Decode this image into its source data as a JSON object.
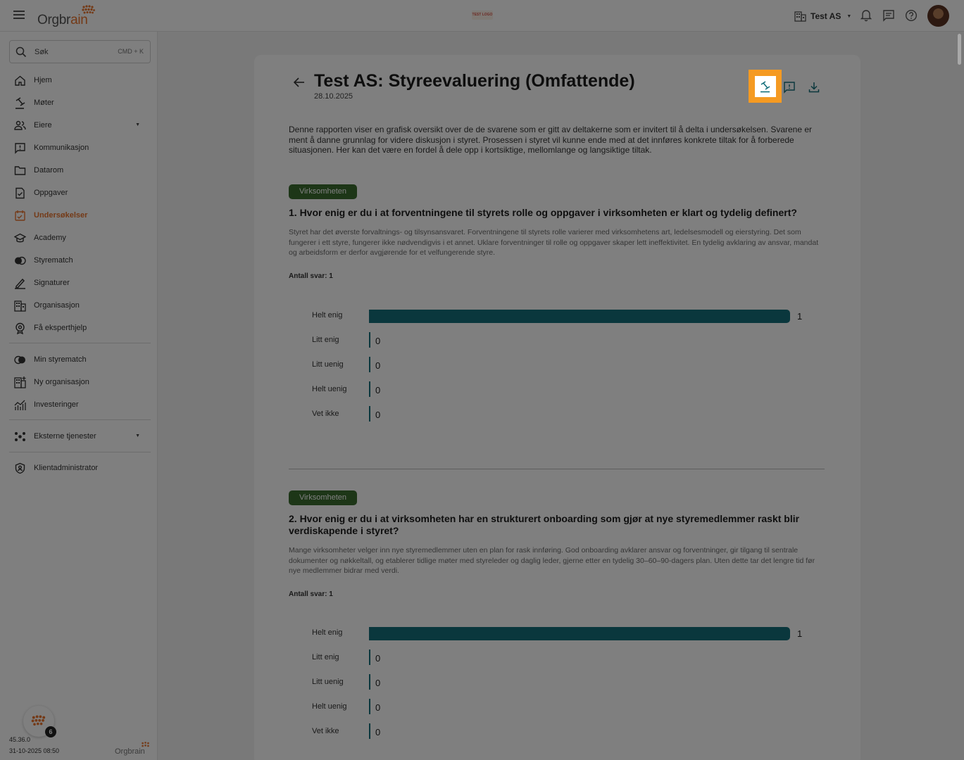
{
  "topbar": {
    "logo_text_main": "Orgbr",
    "logo_text_accent": "ain",
    "center_logo": "TEST LOGO",
    "org_name": "Test AS"
  },
  "sidebar": {
    "search_label": "Søk",
    "search_shortcut": "CMD + K",
    "items": [
      {
        "label": "Hjem",
        "icon": "home-icon"
      },
      {
        "label": "Møter",
        "icon": "gavel-icon"
      },
      {
        "label": "Eiere",
        "icon": "people-icon"
      },
      {
        "label": "Kommunikasjon",
        "icon": "chat-icon"
      },
      {
        "label": "Datarom",
        "icon": "folder-icon"
      },
      {
        "label": "Oppgaver",
        "icon": "task-icon"
      },
      {
        "label": "Undersøkelser",
        "icon": "survey-icon"
      },
      {
        "label": "Academy",
        "icon": "graduation-cap-icon"
      },
      {
        "label": "Styrematch",
        "icon": "match-icon"
      },
      {
        "label": "Signaturer",
        "icon": "signature-icon"
      },
      {
        "label": "Organisasjon",
        "icon": "building-icon"
      },
      {
        "label": "Få eksperthjelp",
        "icon": "expert-help-icon"
      }
    ],
    "items2": [
      {
        "label": "Min styrematch",
        "icon": "toggle-icon"
      },
      {
        "label": "Ny organisasjon",
        "icon": "new-building-icon"
      },
      {
        "label": "Investeringer",
        "icon": "investment-chart-icon"
      }
    ],
    "external": "Eksterne tjenester",
    "admin": "Klientadministrator",
    "bubble_badge": "6",
    "version": "45.36.0",
    "build_date": "31-10-2025 08:50",
    "footer_logo": "Orgbrain"
  },
  "report": {
    "title": "Test AS: Styreevaluering (Omfattende)",
    "date": "28.10.2025",
    "intro": "Denne rapporten viser en grafisk oversikt over de de svarene som er gitt av deltakerne som er invitert til å delta i undersøkelsen. Svarene er ment å danne grunnlag for videre diskusjon i styret. Prosessen i styret vil kunne ende med at det innføres konkrete tiltak for å forberede situasjonen. Her kan det være en fordel å dele opp i kortsiktige, mellomlange og langsiktige tiltak."
  },
  "questions": [
    {
      "tag": "Virksomheten",
      "title": "1. Hvor enig er du i at forventningene til styrets rolle og oppgaver i virksomheten er klart og tydelig definert?",
      "description": "Styret har det øverste forvaltnings- og tilsynsansvaret. Forventningene til styrets rolle varierer med virksomhetens art, ledelsesmodell og eierstyring. Det som fungerer i ett styre, fungerer ikke nødvendigvis i et annet. Uklare forventninger til rolle og oppgaver skaper lett ineffektivitet. En tydelig avklaring av ansvar, mandat og arbeidsform er derfor avgjørende for et velfungerende styre.",
      "count_label": "Antall svar: 1"
    },
    {
      "tag": "Virksomheten",
      "title": "2. Hvor enig er du i at virksomheten har en strukturert onboarding som gjør at nye styremedlemmer raskt blir verdiskapende i styret?",
      "description": "Mange virksomheter velger inn nye styremedlemmer uten en plan for rask innføring. God onboarding avklarer ansvar og forventninger, gir tilgang til sentrale dokumenter og nøkkeltall, og etablerer tidlige møter med styreleder og daglig leder, gjerne etter en tydelig 30–60–90-dagers plan. Uten dette tar det lengre tid før nye medlemmer bidrar med verdi.",
      "count_label": "Antall svar: 1"
    }
  ],
  "chart_data": [
    {
      "type": "bar",
      "categories": [
        "Helt enig",
        "Litt enig",
        "Litt uenig",
        "Helt uenig",
        "Vet ikke"
      ],
      "values": [
        1,
        0,
        0,
        0,
        0
      ],
      "xlim": [
        0,
        1
      ],
      "color": "#146f7b"
    },
    {
      "type": "bar",
      "categories": [
        "Helt enig",
        "Litt enig",
        "Litt uenig",
        "Helt uenig",
        "Vet ikke"
      ],
      "values": [
        1,
        0,
        0,
        0,
        0
      ],
      "xlim": [
        0,
        1
      ],
      "color": "#146f7b"
    }
  ],
  "colors": {
    "accent": "#e8742e",
    "highlight": "#f59a22",
    "tag_green": "#3b6d2f",
    "bar_teal": "#146f7b"
  }
}
